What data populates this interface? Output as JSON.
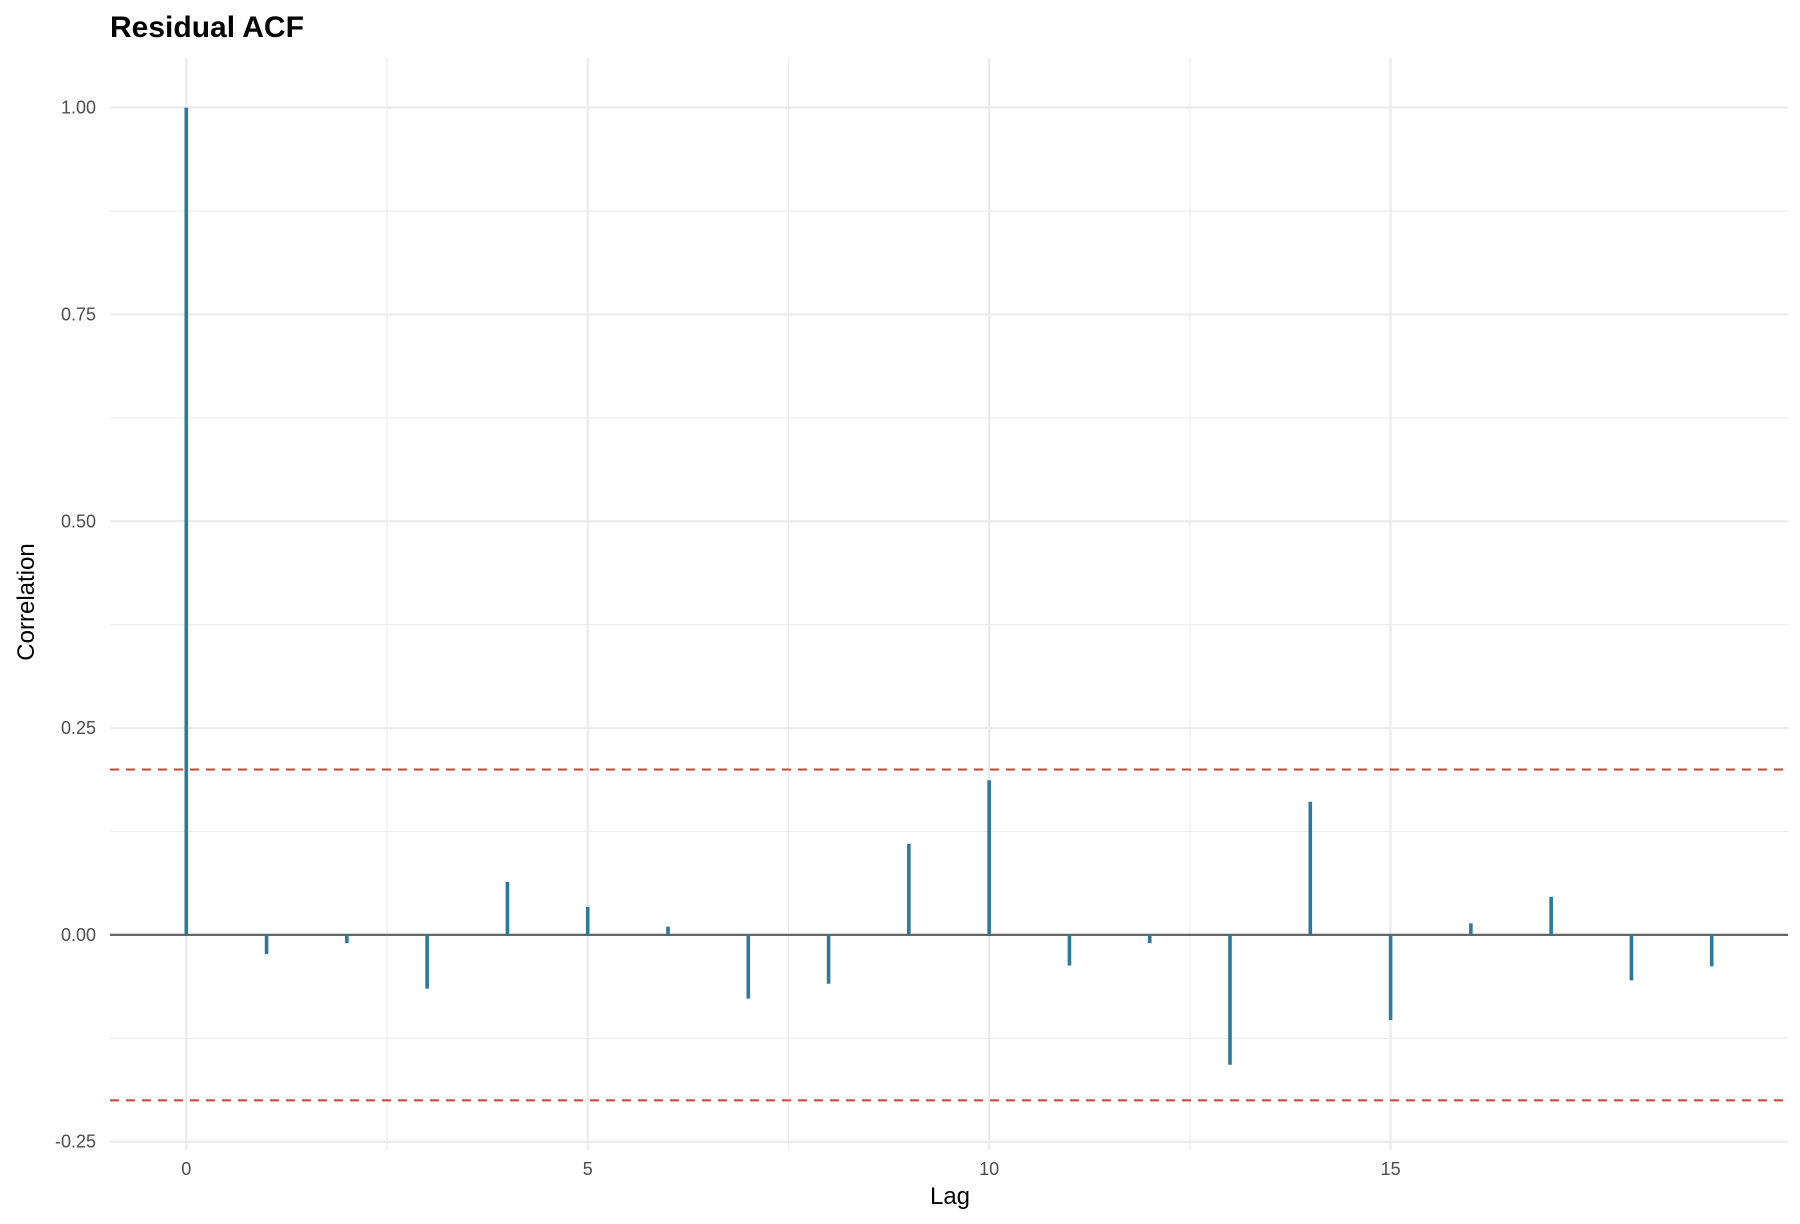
{
  "chart_data": {
    "type": "bar",
    "title": "Residual ACF",
    "xlabel": "Lag",
    "ylabel": "Correlation",
    "x": [
      0,
      1,
      2,
      3,
      4,
      5,
      6,
      7,
      8,
      9,
      10,
      11,
      12,
      13,
      14,
      15,
      16,
      17,
      18,
      19
    ],
    "values": [
      1.0,
      -0.023,
      -0.01,
      -0.065,
      0.064,
      0.034,
      0.01,
      -0.077,
      -0.059,
      0.11,
      0.187,
      -0.037,
      -0.01,
      -0.157,
      0.161,
      -0.103,
      0.014,
      0.046,
      -0.055,
      -0.038
    ],
    "xlim": [
      -0.95,
      19.95
    ],
    "ylim": [
      -0.26,
      1.06
    ],
    "xticks": [
      0,
      5,
      10,
      15
    ],
    "yticks": [
      -0.25,
      0,
      0.25,
      0.5,
      0.75,
      1.0
    ],
    "xtick_labels": [
      "0",
      "5",
      "10",
      "15"
    ],
    "ytick_labels": [
      "-0.25",
      "0.00",
      "0.25",
      "0.50",
      "0.75",
      "1.00"
    ],
    "confidence_bounds": [
      0.2,
      -0.2
    ],
    "grid": true,
    "colors": {
      "bars": "#2b7a9e",
      "confidence": "#cb4335",
      "zero_line": "#666666",
      "grid": "#ebebeb"
    }
  }
}
